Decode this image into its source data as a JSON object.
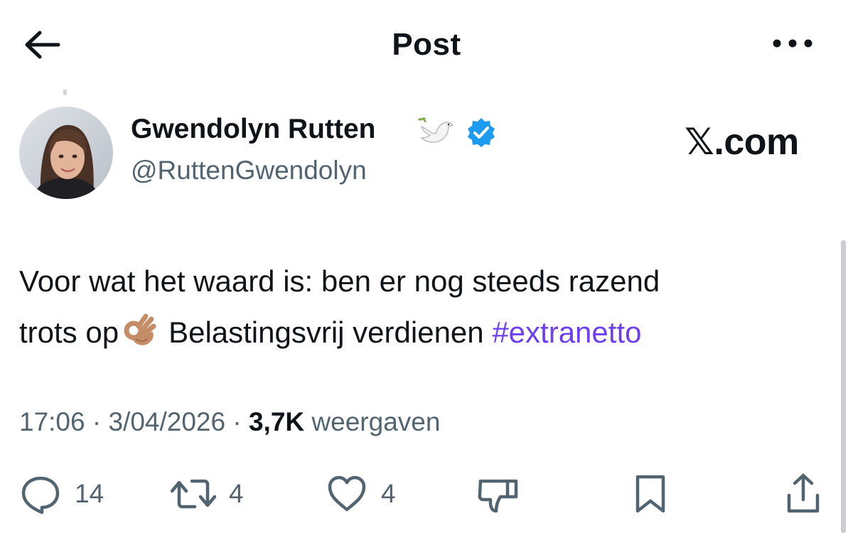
{
  "header": {
    "title": "Post",
    "back_icon": "arrow-left-icon",
    "more_icon": "more-horizontal-icon"
  },
  "author": {
    "name": "Gwendolyn Rutten",
    "handle": "@RuttenGwendolyn",
    "verified": true,
    "verified_color": "#1d9bf0",
    "name_emoji": "dove-icon"
  },
  "brand": {
    "label": "𝕏.com"
  },
  "tweet": {
    "line1": "Voor wat het waard is: ben er nog steeds razend",
    "line2_before": "trots op",
    "emoji": "ok-hand-icon",
    "line2_after": "Belastingsvrij verdienen",
    "hashtag": "#extranetto",
    "hashtag_color": "#6e3ef2"
  },
  "meta": {
    "time": "17:06",
    "separator": "·",
    "date": "3/04/2026",
    "views_count": "3,7K",
    "views_label": "weergaven"
  },
  "actions": {
    "reply_count": "14",
    "repost_count": "4",
    "like_count": "4",
    "icons": [
      "reply-icon",
      "repost-icon",
      "like-icon",
      "dislike-icon",
      "bookmark-icon",
      "share-icon"
    ]
  }
}
